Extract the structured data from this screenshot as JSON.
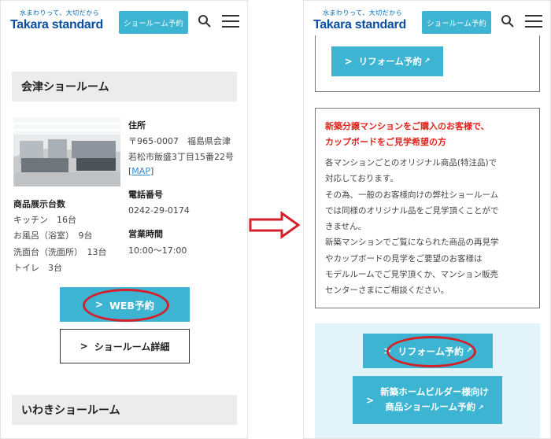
{
  "header": {
    "tagline": "水まわりって、大切だから",
    "logo": "Takara standard",
    "reserve_label": "ショールーム予約"
  },
  "left": {
    "showroom_title": "会津ショールーム",
    "address_heading": "住所",
    "address_lines": [
      "〒965-0007　福島県会津",
      "若松市飯盛3丁目15番22号"
    ],
    "map_link": "MAP",
    "display_heading": "商品展示台数",
    "display_items": [
      "キッチン　16台",
      "お風呂（浴室）　9台",
      "洗面台（洗面所）　13台",
      "トイレ　3台"
    ],
    "phone_heading": "電話番号",
    "phone": "0242-29-0174",
    "hours_heading": "営業時間",
    "hours": "10:00～17:00",
    "web_reserve": "WEB予約",
    "showroom_detail": "ショールーム詳細",
    "next_title": "いわきショールーム"
  },
  "right": {
    "reform_reserve_top": "リフォーム予約",
    "notice_title_lines": [
      "新築分譲マンションをご購入のお客様で、",
      "カップボードをご見学希望の方"
    ],
    "notice_body_lines": [
      "各マンションごとのオリジナル商品(特注品)で",
      "対応しております。",
      "その為、一般のお客様向けの弊社ショールーム",
      "では同様のオリジナル品をご見学頂くことがで",
      "きません。",
      "新築マンションでご覧になられた商品の再見学",
      "やカップボードの見学をご要望のお客様は",
      "モデルルームでご見学頂くか、マンション販売",
      "センターさまにご相談ください。"
    ],
    "reform_reserve": "リフォーム予約",
    "builder_lines": [
      "新築ホームビルダー様向け",
      "商品ショールーム予約"
    ]
  },
  "colors": {
    "accent": "#3cb4d2",
    "logo": "#0a4fa2",
    "highlight": "#d4202a",
    "notice": "#e2231a",
    "panel_bg": "#e3f3fa"
  }
}
